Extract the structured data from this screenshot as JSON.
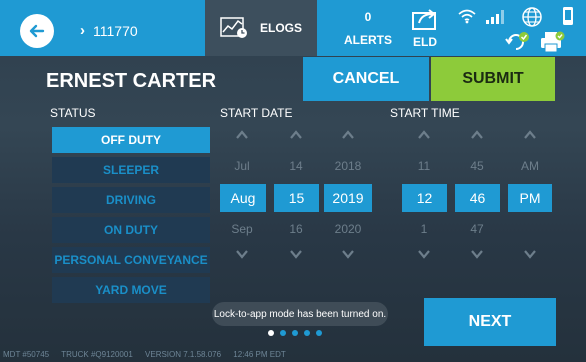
{
  "topbar": {
    "vehicle_chevron": "›",
    "vehicle_number": "111770",
    "elogs_label": "ELOGS",
    "alerts_count": "0",
    "alerts_label": "ALERTS",
    "eld_label": "ELD"
  },
  "header": {
    "driver_name": "ERNEST CARTER",
    "cancel_label": "CANCEL",
    "submit_label": "SUBMIT"
  },
  "labels": {
    "status": "STATUS",
    "start_date": "START DATE",
    "start_time": "START TIME"
  },
  "status_options": [
    {
      "label": "OFF DUTY",
      "selected": true
    },
    {
      "label": "SLEEPER",
      "selected": false
    },
    {
      "label": "DRIVING",
      "selected": false
    },
    {
      "label": "ON DUTY",
      "selected": false
    },
    {
      "label": "PERSONAL CONVEYANCE",
      "selected": false
    },
    {
      "label": "YARD MOVE",
      "selected": false
    }
  ],
  "date_picker": {
    "month": {
      "prev": "Jul",
      "current": "Aug",
      "next": "Sep"
    },
    "day": {
      "prev": "14",
      "current": "15",
      "next": "16"
    },
    "year": {
      "prev": "2018",
      "current": "2019",
      "next": "2020"
    }
  },
  "time_picker": {
    "hour": {
      "prev": "11",
      "current": "12",
      "next": "1"
    },
    "minute": {
      "prev": "45",
      "current": "46",
      "next": "47"
    },
    "ampm": {
      "prev": "AM",
      "current": "PM",
      "next": ""
    }
  },
  "toast": "Lock-to-app mode has been turned on.",
  "pagination": {
    "total": 5,
    "active_index": 0
  },
  "next_label": "NEXT",
  "footer": {
    "mdt": "MDT #50745",
    "truck": "TRUCK #Q9120001",
    "version": "VERSION  7.1.58.076",
    "time": "12:46 PM EDT"
  },
  "colors": {
    "accent": "#1f9ad3",
    "submit": "#8dcb3a",
    "background": "#2e3f4d"
  },
  "icons": [
    "back-arrow-icon",
    "chevron-right-icon",
    "elogs-chart-icon",
    "eld-share-icon",
    "wifi-icon",
    "signal-bars-icon",
    "globe-icon",
    "phone-icon",
    "refresh-check-icon",
    "printer-check-icon"
  ]
}
